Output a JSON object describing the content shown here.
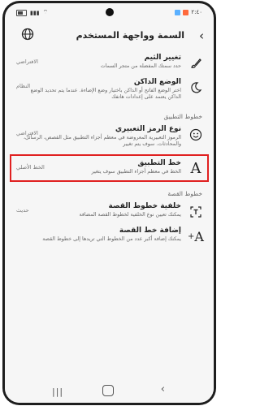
{
  "status_bar": {
    "time": "٢:٤٠"
  },
  "header": {
    "title": "السمة وواجهة المستخدم",
    "back_icon": "‹"
  },
  "items_top": [
    {
      "title": "تغيير الثيم",
      "desc": "حدد سمتك المفضلة من متجر السمات",
      "value": "الافتراضي",
      "icon": "brush-icon"
    },
    {
      "title": "الوضع الداكن",
      "desc": "اختر الوضع الفاتح أو الداكن باختيار وضع الإضاءة. عندما يتم تحديد الوضع الداكن يعتمد على إعدادات هاتفك",
      "value": "النظام",
      "icon": "moon-icon"
    }
  ],
  "section_app_font": "خطوط التطبيق",
  "items_mid": [
    {
      "title": "نوع الرمز التعبيري",
      "desc": "الرموز التعبيرية المعروضة في معظم أجزاء التطبيق مثل القصص، الرسائل، والمحادثات. سوف يتم تغيير",
      "value": "الافتراضي",
      "icon": "emoji-icon"
    }
  ],
  "highlight_item": {
    "title": "خط التطبيق",
    "desc": "الخط في معظم أجزاء التطبيق سوف يتغير",
    "value": "الخط الأصلي",
    "icon": "font-icon"
  },
  "section_story_font": "خطوط القصة",
  "items_bottom": [
    {
      "title": "خلفية خطوط القصة",
      "desc": "يمكنك تعيين نوع الخلفية لخطوط القصة المضافة",
      "value": "حديث",
      "icon": "text-box-icon"
    },
    {
      "title": "إضافة خط القصة",
      "desc": "يمكنك إضافة أكبر عدد من الخطوط التي تريدها إلى خطوط القصة",
      "value": "",
      "icon": "add-font-icon"
    }
  ],
  "nav": {
    "recent": "|||",
    "back": "‹"
  }
}
